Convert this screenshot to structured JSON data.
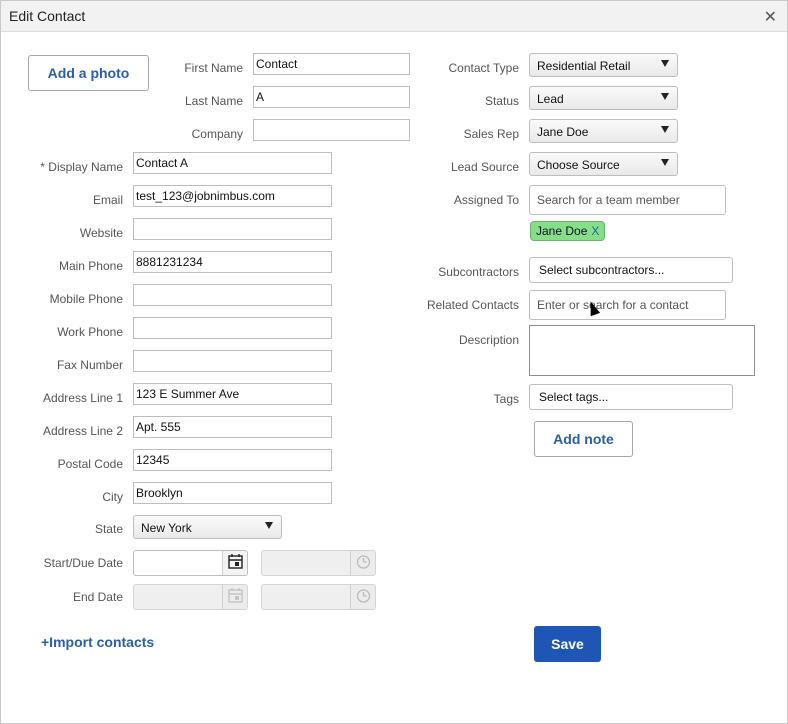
{
  "dialog": {
    "title": "Edit Contact",
    "close_symbol": "✕"
  },
  "photo": {
    "button_label": "Add a photo"
  },
  "left": {
    "first_name": {
      "label": "First Name",
      "value": "Contact"
    },
    "last_name": {
      "label": "Last Name",
      "value": "A"
    },
    "company": {
      "label": "Company",
      "value": ""
    },
    "display_name": {
      "label": "* Display Name",
      "value": "Contact A"
    },
    "email": {
      "label": "Email",
      "value": "test_123@jobnimbus.com"
    },
    "website": {
      "label": "Website",
      "value": ""
    },
    "main_phone": {
      "label": "Main Phone",
      "value": "8881231234"
    },
    "mobile_phone": {
      "label": "Mobile Phone",
      "value": ""
    },
    "work_phone": {
      "label": "Work Phone",
      "value": ""
    },
    "fax_number": {
      "label": "Fax Number",
      "value": ""
    },
    "address1": {
      "label": "Address Line 1",
      "value": "123 E Summer Ave"
    },
    "address2": {
      "label": "Address Line 2",
      "value": "Apt. 555"
    },
    "postal_code": {
      "label": "Postal Code",
      "value": "12345"
    },
    "city": {
      "label": "City",
      "value": "Brooklyn"
    },
    "state": {
      "label": "State",
      "value": "New York"
    },
    "start_due": {
      "label": "Start/Due Date"
    },
    "end_date": {
      "label": "End Date"
    },
    "import_label": "+Import contacts"
  },
  "right": {
    "contact_type": {
      "label": "Contact Type",
      "value": "Residential Retail"
    },
    "status": {
      "label": "Status",
      "value": "Lead"
    },
    "sales_rep": {
      "label": "Sales Rep",
      "value": "Jane Doe"
    },
    "lead_source": {
      "label": "Lead Source",
      "value": "Choose Source"
    },
    "assigned_to": {
      "label": "Assigned To",
      "placeholder": "Search for a team member",
      "chip": "Jane Doe",
      "chip_remove": "X"
    },
    "subcontractors": {
      "label": "Subcontractors",
      "value": "Select subcontractors..."
    },
    "related_contacts": {
      "label": "Related Contacts",
      "placeholder": "Enter or search for a contact"
    },
    "description": {
      "label": "Description"
    },
    "tags": {
      "label": "Tags",
      "value": "Select tags..."
    },
    "add_note_label": "Add note",
    "save_label": "Save"
  },
  "colors": {
    "accent": "#1f56b5",
    "chip_bg": "#86df86"
  }
}
